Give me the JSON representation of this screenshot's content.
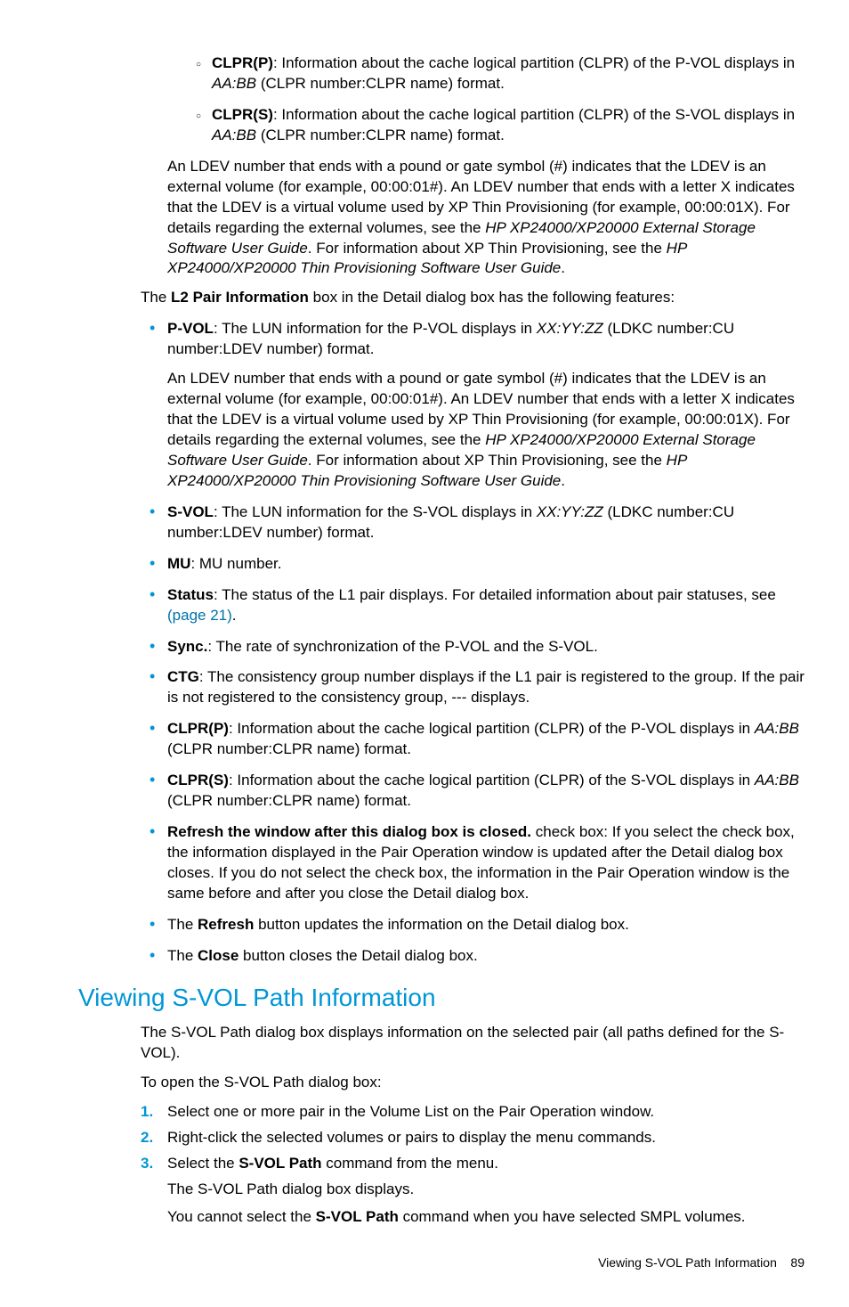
{
  "sub_bullets": [
    {
      "bold": "CLPR(P)",
      "rest": ": Information about the cache logical partition (CLPR) of the P-VOL displays in",
      "line2_italic": "AA:BB",
      "line2_rest": " (CLPR number:CLPR name) format."
    },
    {
      "bold": "CLPR(S)",
      "rest": ": Information about the cache logical partition (CLPR) of the S-VOL displays in",
      "line2_italic": "AA:BB",
      "line2_rest": " (CLPR number:CLPR name) format."
    }
  ],
  "ldev_para": {
    "t1": "An LDEV number that ends with a pound or gate symbol (#) indicates that the LDEV is an external volume (for example, 00:00:01#). An LDEV number that ends with a letter X indicates that the LDEV is a virtual volume used by XP Thin Provisioning (for example, 00:00:01X). For details regarding the external volumes, see the ",
    "i1": "HP XP24000/XP20000 External Storage Software User Guide",
    "t2": ". For information about XP Thin Provisioning, see the ",
    "i2": "HP XP24000/XP20000 Thin Provisioning Software User Guide",
    "t3": "."
  },
  "l2_intro": {
    "t1": "The ",
    "b1": "L2 Pair Information",
    "t2": " box in the Detail dialog box has the following features:"
  },
  "bullets": {
    "pvol": {
      "b": "P-VOL",
      "t1": ": The LUN information for the P-VOL displays in ",
      "i": "XX:YY:ZZ",
      "t2": " (LDKC number:CU number:LDEV number) format."
    },
    "pvol_sub": {
      "t1": "An LDEV number that ends with a pound or gate symbol (#) indicates that the LDEV is an external volume (for example, 00:00:01#). An LDEV number that ends with a letter X indicates that the LDEV is a virtual volume used by XP Thin Provisioning (for example, 00:00:01X). For details regarding the external volumes, see the ",
      "i1": "HP XP24000/XP20000 External Storage Software User Guide",
      "t2": ". For information about XP Thin Provisioning, see the ",
      "i2": "HP XP24000/XP20000 Thin Provisioning Software User Guide",
      "t3": "."
    },
    "svol": {
      "b": "S-VOL",
      "t1": ": The LUN information for the S-VOL displays in ",
      "i": "XX:YY:ZZ",
      "t2": " (LDKC number:CU number:LDEV number) format."
    },
    "mu": {
      "b": "MU",
      "t": ": MU number."
    },
    "status": {
      "b": "Status",
      "t1": ": The status of the L1 pair displays. For detailed information about pair statuses, see ",
      "link": "(page 21)",
      "t2": "."
    },
    "sync": {
      "b": "Sync.",
      "t": ": The rate of synchronization of the P-VOL and the S-VOL."
    },
    "ctg": {
      "b": "CTG",
      "t": ": The consistency group number displays if the L1 pair is registered to the group. If the pair is not registered to the consistency group, --- displays."
    },
    "clprp": {
      "b": "CLPR(P)",
      "t1": ": Information about the cache logical partition (CLPR) of the P-VOL displays in ",
      "i": "AA:BB",
      "t2": " (CLPR number:CLPR name) format."
    },
    "clprs": {
      "b": "CLPR(S)",
      "t1": ": Information about the cache logical partition (CLPR) of the S-VOL displays in ",
      "i": "AA:BB",
      "t2": " (CLPR number:CLPR name) format."
    },
    "refresh_chk": {
      "b": "Refresh the window after this dialog box is closed.",
      "t": " check box: If you select the check box, the information displayed in the Pair Operation window is updated after the Detail dialog box closes. If you do not select the check box, the information in the Pair Operation window is the same before and after you close the Detail dialog box."
    },
    "refresh_btn": {
      "t1": "The ",
      "b": "Refresh",
      "t2": " button updates the information on the Detail dialog box."
    },
    "close_btn": {
      "t1": "The ",
      "b": "Close",
      "t2": " button closes the Detail dialog box."
    }
  },
  "section_heading": "Viewing S-VOL Path Information",
  "svol_p1": "The S-VOL Path dialog box displays information on the selected pair (all paths defined for the S-VOL).",
  "svol_p2": "To open the S-VOL Path dialog box:",
  "steps": [
    {
      "n": "1.",
      "t": "Select one or more pair in the Volume List on the Pair Operation window."
    },
    {
      "n": "2.",
      "t": "Right-click the selected volumes or pairs to display the menu commands."
    },
    {
      "n": "3.",
      "t1": "Select the ",
      "b": "S-VOL Path",
      "t2": " command from the menu."
    }
  ],
  "step3_sub1": "The S-VOL Path dialog box displays.",
  "step3_sub2": {
    "t1": "You cannot select the ",
    "b": "S-VOL Path",
    "t2": " command when you have selected SMPL volumes."
  },
  "footer": {
    "label": "Viewing S-VOL Path Information",
    "page": "89"
  }
}
